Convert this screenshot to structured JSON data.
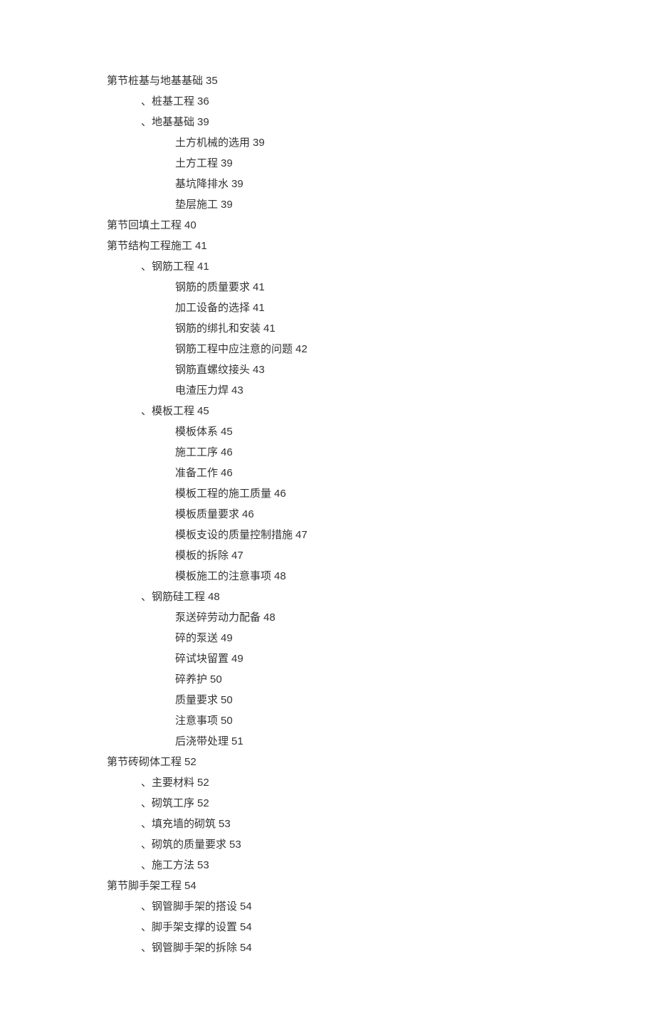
{
  "toc": [
    {
      "level": 0,
      "title": "第节桩基与地基基础",
      "page": "35"
    },
    {
      "level": 1,
      "title": "、桩基工程",
      "page": "36"
    },
    {
      "level": 1,
      "title": "、地基基础",
      "page": "39"
    },
    {
      "level": 2,
      "title": "土方机械的选用",
      "page": "39"
    },
    {
      "level": 2,
      "title": "土方工程",
      "page": "39"
    },
    {
      "level": 2,
      "title": "基坑降排水",
      "page": "39"
    },
    {
      "level": 2,
      "title": "垫层施工",
      "page": "39"
    },
    {
      "level": 0,
      "title": "第节回填土工程",
      "page": "40"
    },
    {
      "level": 0,
      "title": "第节结构工程施工",
      "page": "41"
    },
    {
      "level": 1,
      "title": "、钢筋工程",
      "page": "41"
    },
    {
      "level": 2,
      "title": "钢筋的质量要求",
      "page": "41"
    },
    {
      "level": 2,
      "title": "加工设备的选择",
      "page": "41"
    },
    {
      "level": 2,
      "title": "钢筋的绑扎和安装",
      "page": "41"
    },
    {
      "level": 2,
      "title": "钢筋工程中应注意的问题",
      "page": "42"
    },
    {
      "level": 2,
      "title": "钢筋直螺纹接头",
      "page": "43"
    },
    {
      "level": 2,
      "title": "电渣压力焊",
      "page": "43"
    },
    {
      "level": 1,
      "title": "、模板工程",
      "page": "45"
    },
    {
      "level": 2,
      "title": "模板体系",
      "page": "45"
    },
    {
      "level": 2,
      "title": "施工工序",
      "page": "46"
    },
    {
      "level": 2,
      "title": "准备工作",
      "page": "46"
    },
    {
      "level": 2,
      "title": "模板工程的施工质量",
      "page": "46"
    },
    {
      "level": 2,
      "title": "模板质量要求",
      "page": "46"
    },
    {
      "level": 2,
      "title": "模板支设的质量控制措施",
      "page": "47"
    },
    {
      "level": 2,
      "title": "模板的拆除",
      "page": "47"
    },
    {
      "level": 2,
      "title": "模板施工的注意事项",
      "page": "48"
    },
    {
      "level": 1,
      "title": "、钢筋硅工程",
      "page": "48"
    },
    {
      "level": 2,
      "title": "泵送碎劳动力配备",
      "page": "48"
    },
    {
      "level": 2,
      "title": "碎的泵送",
      "page": "49"
    },
    {
      "level": 2,
      "title": "碎试块留置",
      "page": "49"
    },
    {
      "level": 2,
      "title": "碎养护",
      "page": "50"
    },
    {
      "level": 2,
      "title": "质量要求",
      "page": "50"
    },
    {
      "level": 2,
      "title": "注意事项",
      "page": "50"
    },
    {
      "level": 2,
      "title": "后浇带处理",
      "page": "51"
    },
    {
      "level": 0,
      "title": "第节砖砌体工程",
      "page": "52"
    },
    {
      "level": 1,
      "title": "、主要材料",
      "page": "52"
    },
    {
      "level": 1,
      "title": "、砌筑工序",
      "page": "52"
    },
    {
      "level": 1,
      "title": "、填充墙的砌筑",
      "page": "53"
    },
    {
      "level": 1,
      "title": "、砌筑的质量要求",
      "page": "53"
    },
    {
      "level": 1,
      "title": "、施工方法",
      "page": "53"
    },
    {
      "level": 0,
      "title": "第节脚手架工程",
      "page": "54"
    },
    {
      "level": 1,
      "title": "、钢管脚手架的搭设",
      "page": "54"
    },
    {
      "level": 1,
      "title": "、脚手架支撑的设置",
      "page": "54"
    },
    {
      "level": 1,
      "title": "、钢管脚手架的拆除",
      "page": "54"
    }
  ]
}
